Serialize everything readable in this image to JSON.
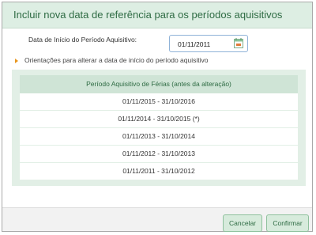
{
  "dialog": {
    "title": "Incluir nova data de referência para os períodos aquisitivos"
  },
  "form": {
    "start_date_label": "Data de Início do Período Aquisitivo:",
    "start_date_value": "01/11/2011",
    "calendar_icon": "calendar-icon"
  },
  "orientation": {
    "link_text": "Orientações para alterar a data de início do período aquisitivo",
    "icon": "arrow-right-icon"
  },
  "table": {
    "header": "Período Aquisitivo de Férias (antes da alteração)",
    "rows": [
      "01/11/2015 - 31/10/2016",
      "01/11/2014 - 31/10/2015 (*)",
      "01/11/2013 - 31/10/2014",
      "01/11/2012 - 31/10/2013",
      "01/11/2011 - 31/10/2012"
    ]
  },
  "buttons": {
    "cancel": "Cancelar",
    "confirm": "Confirmar"
  },
  "colors": {
    "header_bg": "#ddeee3",
    "title_text": "#2e6b43",
    "panel_bg": "#e2efe6",
    "button_bg": "#d7ebdc",
    "accent_arrow": "#e8961e"
  }
}
